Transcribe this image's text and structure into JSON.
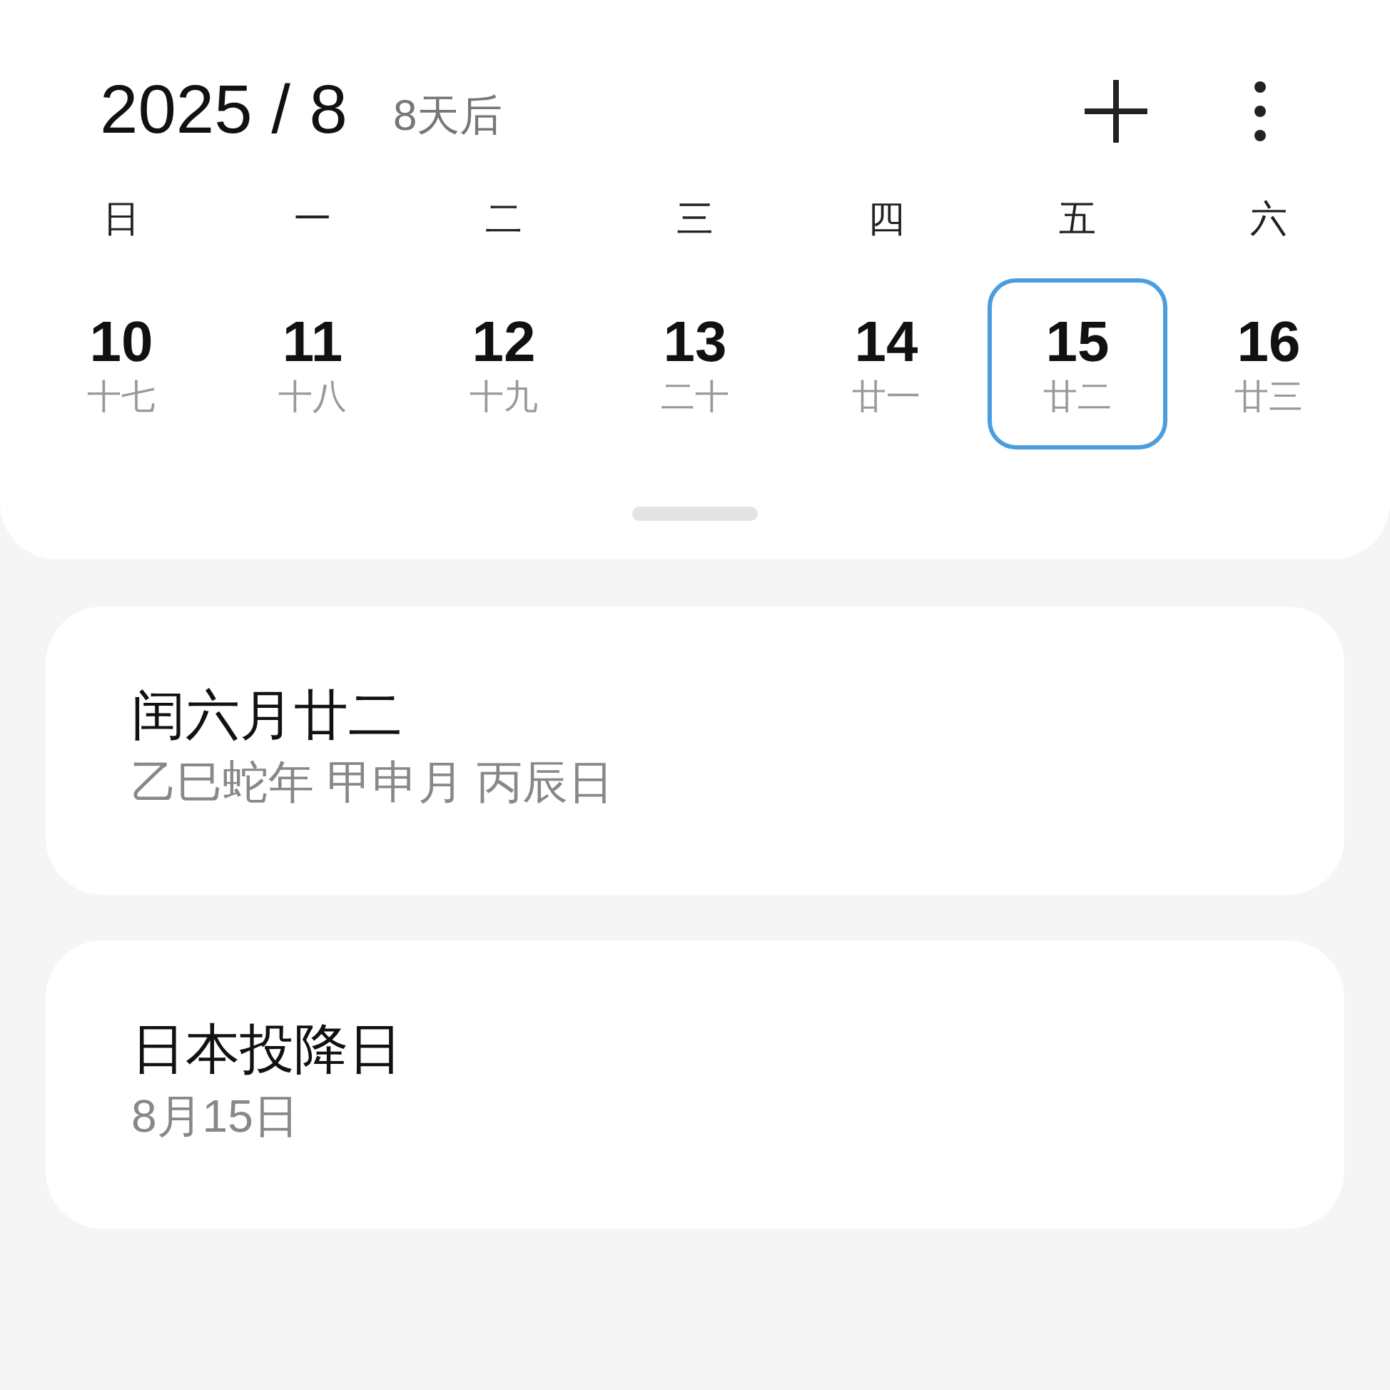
{
  "header": {
    "title": "2025 / 8",
    "countdown": "8天后"
  },
  "weekdays": [
    "日",
    "一",
    "二",
    "三",
    "四",
    "五",
    "六"
  ],
  "days": [
    {
      "day": "10",
      "lunar": "十七",
      "selected": false
    },
    {
      "day": "11",
      "lunar": "十八",
      "selected": false
    },
    {
      "day": "12",
      "lunar": "十九",
      "selected": false
    },
    {
      "day": "13",
      "lunar": "二十",
      "selected": false
    },
    {
      "day": "14",
      "lunar": "廿一",
      "selected": false
    },
    {
      "day": "15",
      "lunar": "廿二",
      "selected": true
    },
    {
      "day": "16",
      "lunar": "廿三",
      "selected": false
    }
  ],
  "cards": [
    {
      "title": "闰六月廿二",
      "subtitle": "乙巳蛇年 甲申月 丙辰日"
    },
    {
      "title": "日本投降日",
      "subtitle": "8月15日"
    }
  ]
}
